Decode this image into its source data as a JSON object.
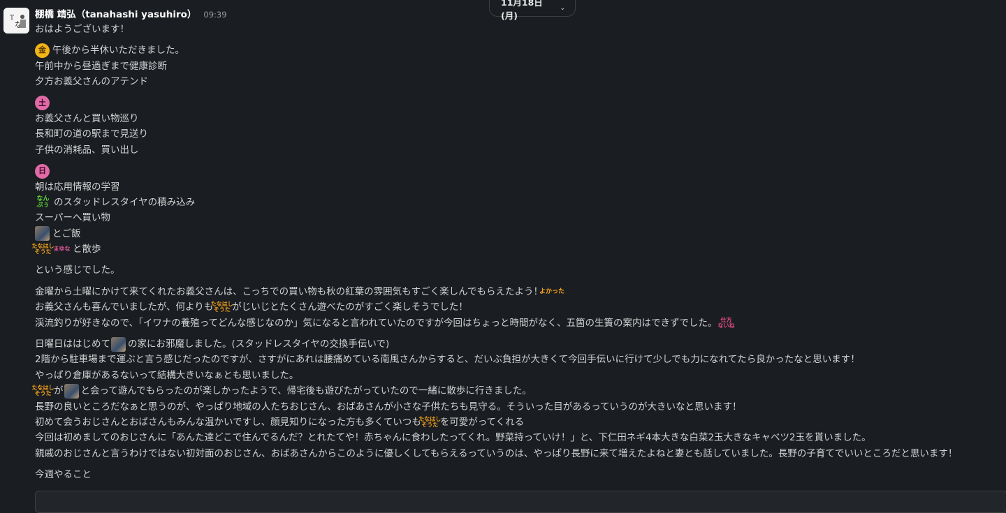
{
  "date_divider": {
    "label": "11月18日 (月)",
    "icon": "chevron-down-icon"
  },
  "message": {
    "author": "棚橋 靖弘（tanahashi yasuhiro）",
    "time": "09:39",
    "lines": {
      "l1": "おはようございます！",
      "l2": "午後から半休いただきました。",
      "l3": "午前中から昼過ぎまで健康診断",
      "l4": "夕方お義父さんのアテンド",
      "l5": "お義父さんと買い物巡り",
      "l6": "長和町の道の駅まで見送り",
      "l7": "子供の消耗品、買い出し",
      "l8": "朝は応用情報の学習",
      "l9": "のスタッドレスタイヤの積み込み",
      "l10": "スーパーへ買い物",
      "l11": "とご飯",
      "l12": "と散歩",
      "l13": "という感じでした。",
      "l14": "金曜から土曜にかけて来てくれたお義父さんは、こっちでの買い物も秋の紅葉の雰囲気もすごく楽しんでもらえたよう！",
      "l15a": "お義父さんも喜んでいましたが、何よりも",
      "l15b": "がじいじとたくさん遊べたのがすごく楽しそうでした！",
      "l16": "渓流釣りが好きなので、「イワナの養殖ってどんな感じなのか」気になると言われていたのですが今回はちょっと時間がなく、五箇の生簀の案内はできずでした。",
      "l17a": "日曜日ははじめて",
      "l17b": "の家にお邪魔しました。(スタッドレスタイヤの交換手伝いで)",
      "l18": "2階から駐車場まで運ぶと言う感じだったのですが、さすがにあれは腰痛めている南風さんからすると、だいぶ負担が大きくて今回手伝いに行けて少しでも力になれてたら良かったなと思います！",
      "l19": "やっぱり倉庫があるないって結構大きいなぁとも思いました。",
      "l20a": "が",
      "l20b": "と会って遊んでもらったのが楽しかったようで、帰宅後も遊びたがっていたので一緒に散歩に行きました。",
      "l21": "長野の良いところだなぁと思うのが、やっぱり地域の人たちおじさん、おばあさんが小さな子供たちも見守る。そういった目があるっていうのが大きいなと思います！",
      "l22a": "初めて会うおじさんとおばさんもみんな温かいですし、顔見知りになった方も多くていつも",
      "l22b": "を可愛がってくれる",
      "l23": "今回は初めましてのおじさんに「あんた達どこで住んでるんだ？とれたてや！赤ちゃんに食わしたってくれ。野菜持っていけ！」と、下仁田ネギ4本大きな白菜2玉大きなキャベツ2玉を貰いました。",
      "l24": "親戚のおじさんと言うわけではない初対面のおじさん、おばあさんからこのように優しくしてもらえるっていうのは、やっぱり長野に来て増えたよねと妻とも話していました。長野の子育てでいいところだと思います！",
      "l25": "今週やること"
    },
    "emoji": {
      "fri": "金",
      "sat": "土",
      "sun": "日",
      "nanpu": [
        "なん",
        "ぷぅ"
      ],
      "tanahashi_souta": [
        "たなはし",
        "そうた"
      ],
      "mayuna": "まゆな",
      "yokatta": "よかった",
      "shikatanai": [
        "仕方",
        "ないね"
      ]
    }
  }
}
